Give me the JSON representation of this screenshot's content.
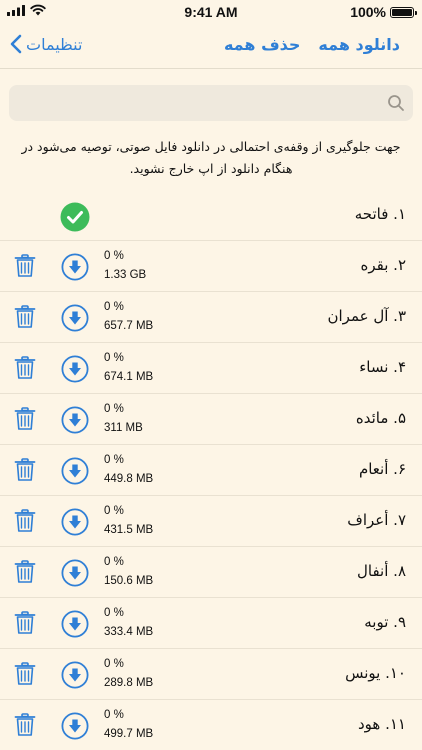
{
  "status": {
    "time": "9:41 AM",
    "battery": "100%"
  },
  "nav": {
    "back_label": "تنظیمات",
    "download_all": "دانلود همه",
    "delete_all": "حذف همه"
  },
  "search": {
    "placeholder": ""
  },
  "notice": "جهت جلوگیری از وقفه‌ی احتمالی در دانلود فایل صوتی، توصیه می‌شود در هنگام دانلود از اپ خارج نشوید.",
  "colors": {
    "accent": "#2f7fd6",
    "success": "#3dbb5a",
    "background": "#fdf5e6"
  },
  "surahs": [
    {
      "name": "۱. فاتحه",
      "downloaded": true
    },
    {
      "name": "۲. بقره",
      "downloaded": false,
      "percent": "0 %",
      "size": "1.33 GB"
    },
    {
      "name": "۳. آل عمران",
      "downloaded": false,
      "percent": "0 %",
      "size": "657.7 MB"
    },
    {
      "name": "۴. نساء",
      "downloaded": false,
      "percent": "0 %",
      "size": "674.1 MB"
    },
    {
      "name": "۵. مائده",
      "downloaded": false,
      "percent": "0 %",
      "size": "311 MB"
    },
    {
      "name": "۶. أنعام",
      "downloaded": false,
      "percent": "0 %",
      "size": "449.8 MB"
    },
    {
      "name": "۷. أعراف",
      "downloaded": false,
      "percent": "0 %",
      "size": "431.5 MB"
    },
    {
      "name": "۸. أنفال",
      "downloaded": false,
      "percent": "0 %",
      "size": "150.6 MB"
    },
    {
      "name": "۹. توبه",
      "downloaded": false,
      "percent": "0 %",
      "size": "333.4 MB"
    },
    {
      "name": "۱۰. یونس",
      "downloaded": false,
      "percent": "0 %",
      "size": "289.8 MB"
    },
    {
      "name": "۱۱. هود",
      "downloaded": false,
      "percent": "0 %",
      "size": "499.7 MB"
    }
  ]
}
